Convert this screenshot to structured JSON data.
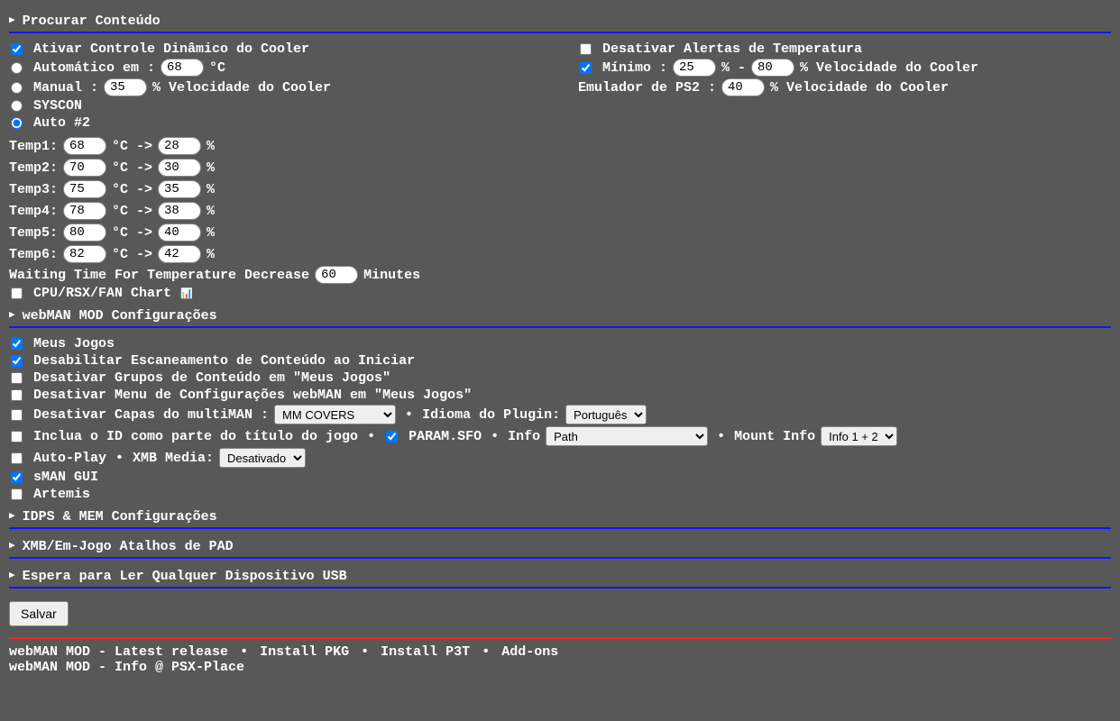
{
  "sections": {
    "procurar": "Procurar Conteúdo",
    "webman": "webMAN MOD Configurações",
    "idps": "IDPS & MEM Configurações",
    "xmb": "XMB/Em-Jogo Atalhos de PAD",
    "usb": "Espera para Ler Qualquer Dispositivo USB"
  },
  "fan": {
    "enable_label": "Ativar Controle Dinâmico do Cooler",
    "disable_temp_warn_label": "Desativar Alertas de Temperatura",
    "auto_label_pre": "Automático em :",
    "auto_val": "68",
    "auto_label_post": "°C",
    "min_label_pre": "Mínimo :",
    "min_val": "25",
    "min_mid": "% -",
    "max_val": "80",
    "min_label_post": "% Velocidade do Cooler",
    "manual_label_pre": "Manual :",
    "manual_val": "35",
    "manual_label_post": "% Velocidade do Cooler",
    "ps2_label_pre": "Emulador de PS2 :",
    "ps2_val": "40",
    "ps2_label_post": "% Velocidade do Cooler",
    "syscon_label": "SYSCON",
    "auto2_label": "Auto #2",
    "temps": [
      {
        "name": "Temp1:",
        "t": "68",
        "p": "28"
      },
      {
        "name": "Temp2:",
        "t": "70",
        "p": "30"
      },
      {
        "name": "Temp3:",
        "t": "75",
        "p": "35"
      },
      {
        "name": "Temp4:",
        "t": "78",
        "p": "38"
      },
      {
        "name": "Temp5:",
        "t": "80",
        "p": "40"
      },
      {
        "name": "Temp6:",
        "t": "82",
        "p": "42"
      }
    ],
    "temp_mid": "°C ->",
    "temp_post": "%",
    "wait_label_pre": "Waiting Time For Temperature Decrease",
    "wait_val": "60",
    "wait_label_post": "Minutes",
    "chart_label": "CPU/RSX/FAN Chart",
    "chart_icon": "📊"
  },
  "wm": {
    "mygames": "Meus Jogos",
    "noscan": "Desabilitar Escaneamento de Conteúdo ao Iniciar",
    "nogroups": "Desativar Grupos de Conteúdo em \"Meus Jogos\"",
    "nosetup": "Desativar Menu de Configurações webMAN em \"Meus Jogos\"",
    "nocovers": "Desativar Capas do multiMAN :",
    "covers_sel": "MM COVERS",
    "lang_label": "Idioma do Plugin:",
    "lang_sel": "Português",
    "incid_label": "Inclua o ID como parte do título do jogo",
    "paramsfo_label": "PARAM.SFO",
    "info_label": "Info",
    "info_sel": "Path",
    "mountinfo_label": "Mount Info",
    "mountinfo_sel": "Info 1 + 2",
    "autoplay_label": "Auto-Play",
    "xmbmedia_label": "XMB Media:",
    "xmbmedia_sel": "Desativado",
    "sman_label": "sMAN GUI",
    "artemis_label": "Artemis"
  },
  "save_btn": "Salvar",
  "footer": {
    "l1": "webMAN MOD - Latest release",
    "l2": "Install PKG",
    "l3": "Install P3T",
    "l4": "Add-ons",
    "l5": "webMAN MOD - Info @ PSX-Place"
  }
}
